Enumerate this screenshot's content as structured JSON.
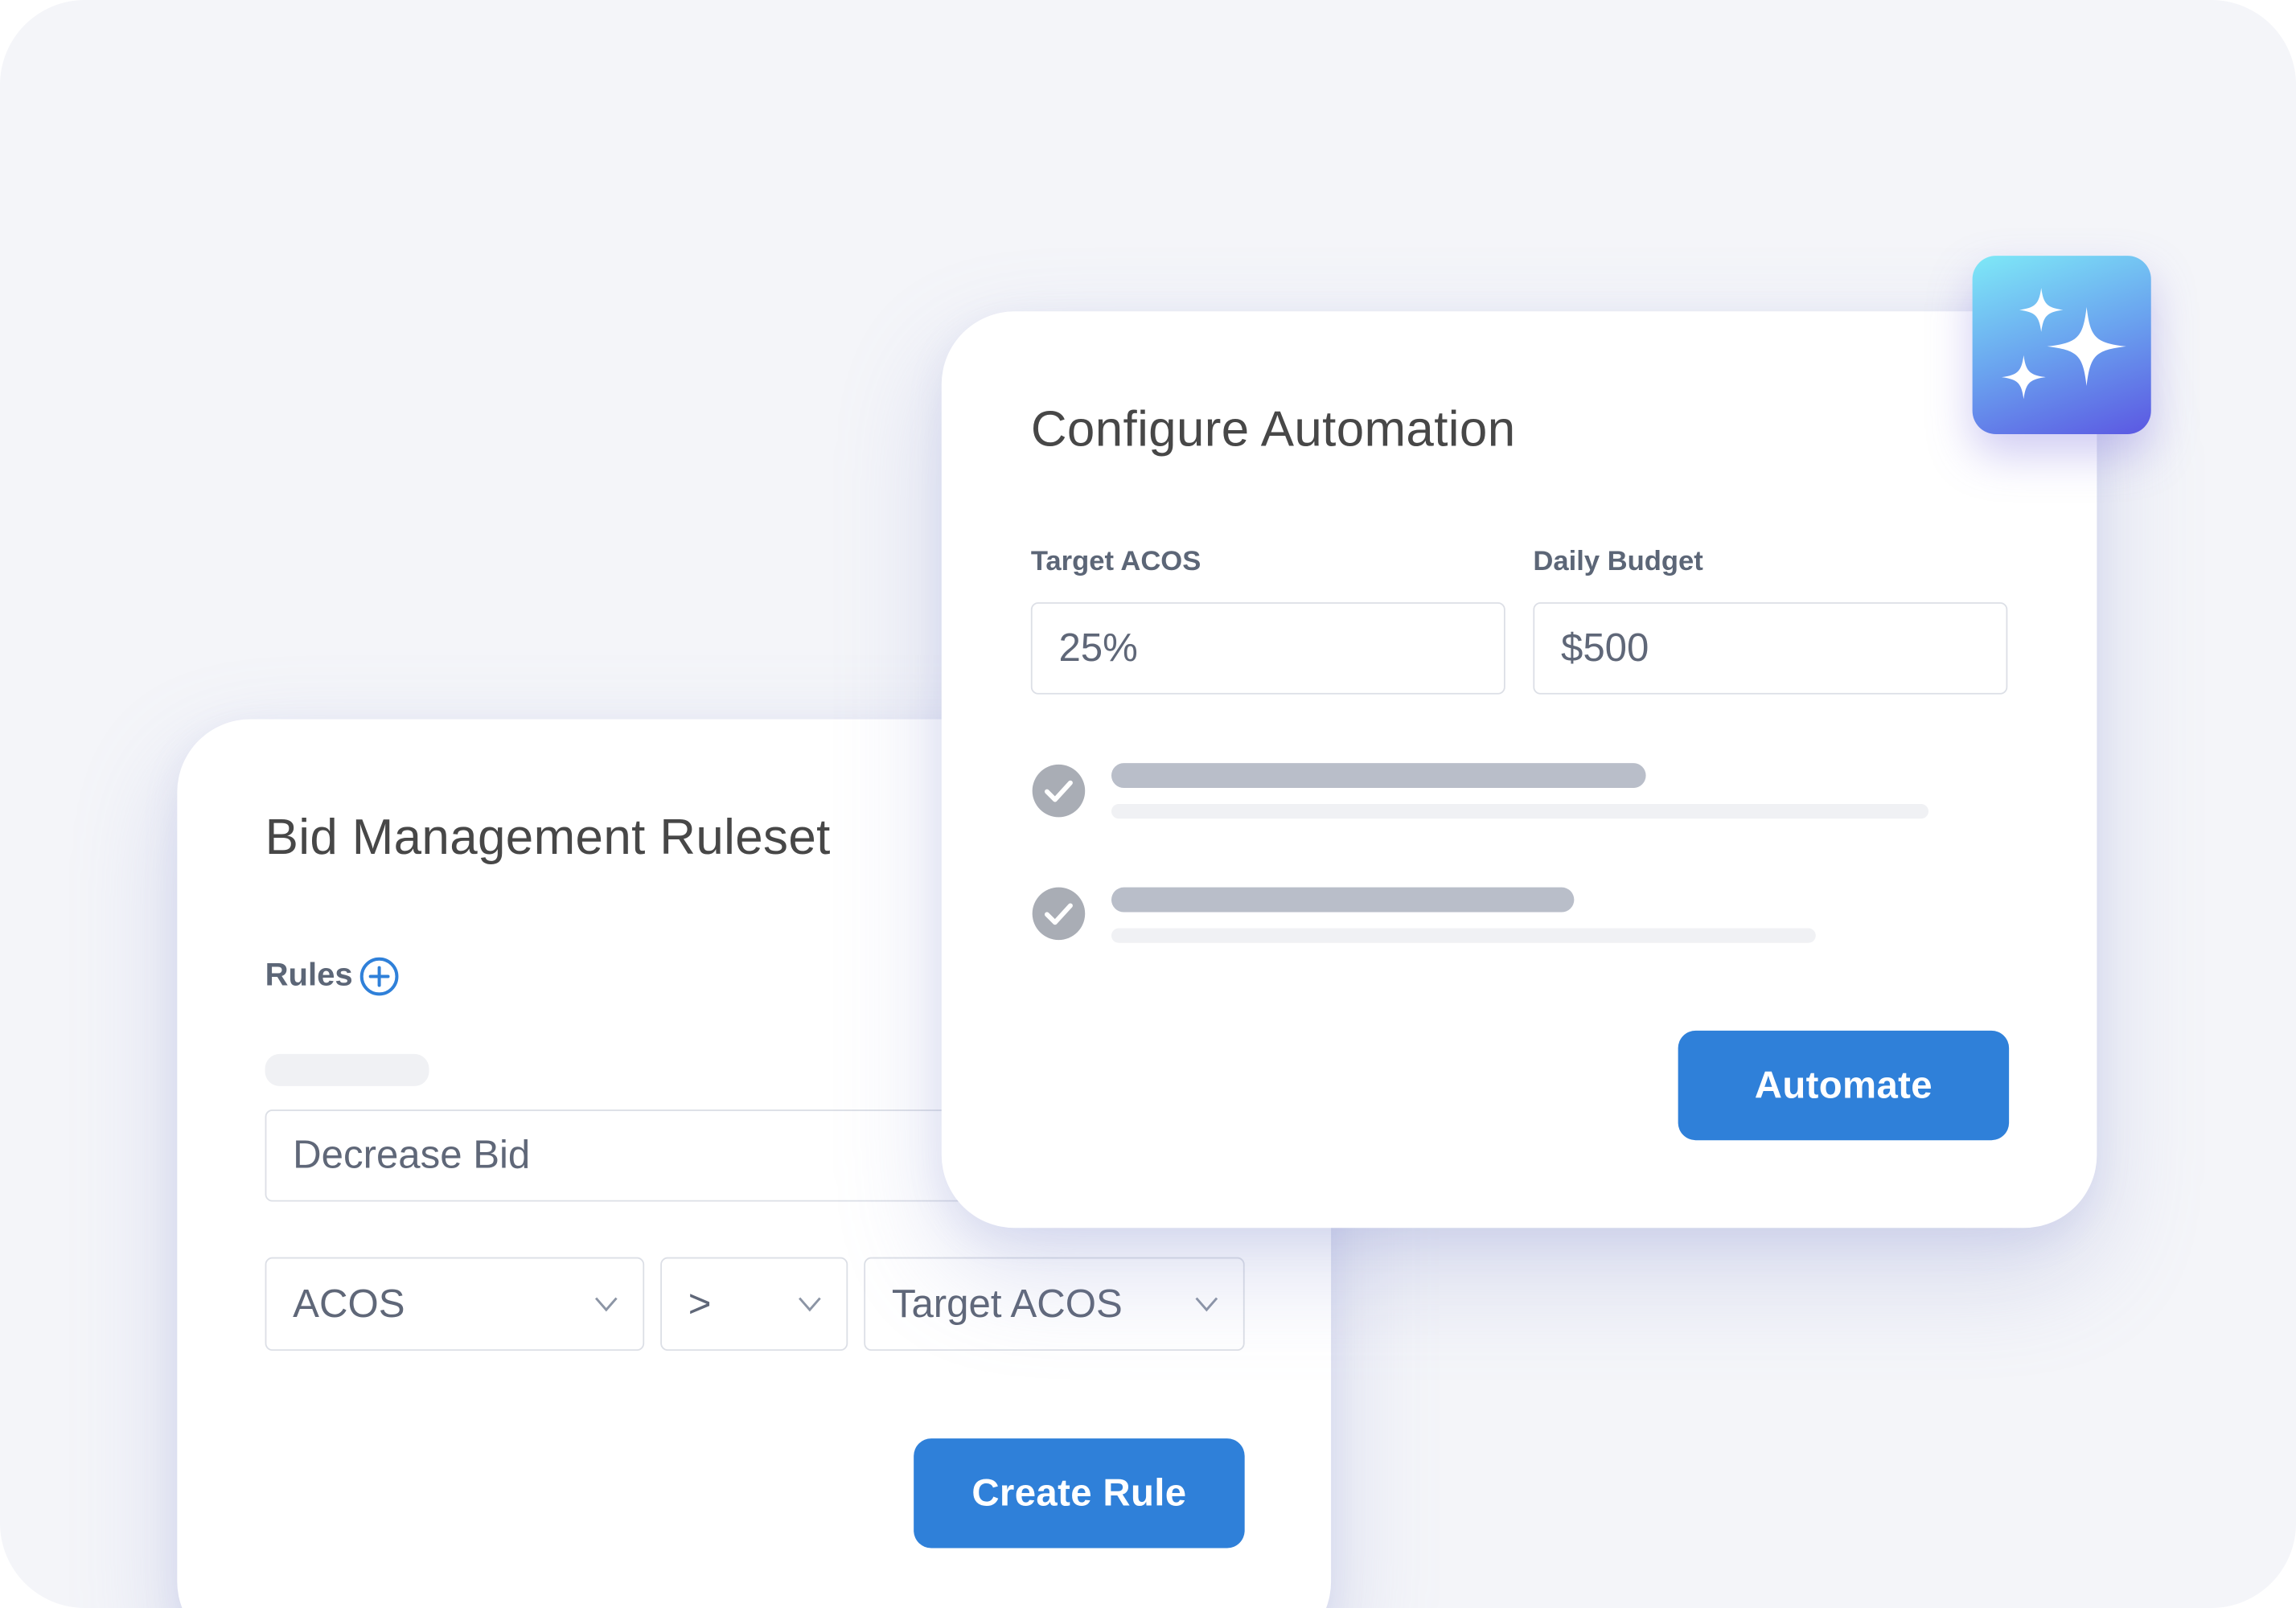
{
  "rules_card": {
    "title": "Bid Management Ruleset",
    "rules_label": "Rules",
    "action_field": "Decrease Bid",
    "metric_select": "ACOS",
    "operator_select": ">",
    "compare_select": "Target ACOS",
    "create_button": "Create Rule"
  },
  "automation_card": {
    "title": "Configure Automation",
    "target_acos_label": "Target ACOS",
    "target_acos_value": "25%",
    "daily_budget_label": "Daily Budget",
    "daily_budget_value": "$500",
    "checklist": [
      {
        "icon": "check-circle-icon",
        "checked": true
      },
      {
        "icon": "check-circle-icon",
        "checked": true
      }
    ],
    "automate_button": "Automate"
  },
  "sparkle_badge": {
    "icon": "sparkles-icon"
  },
  "colors": {
    "background": "#f4f5f9",
    "accent": "#2f80d9",
    "skeleton": "#b9bec9",
    "skeleton_light": "#f0f1f4",
    "check": "#a9adb5"
  }
}
